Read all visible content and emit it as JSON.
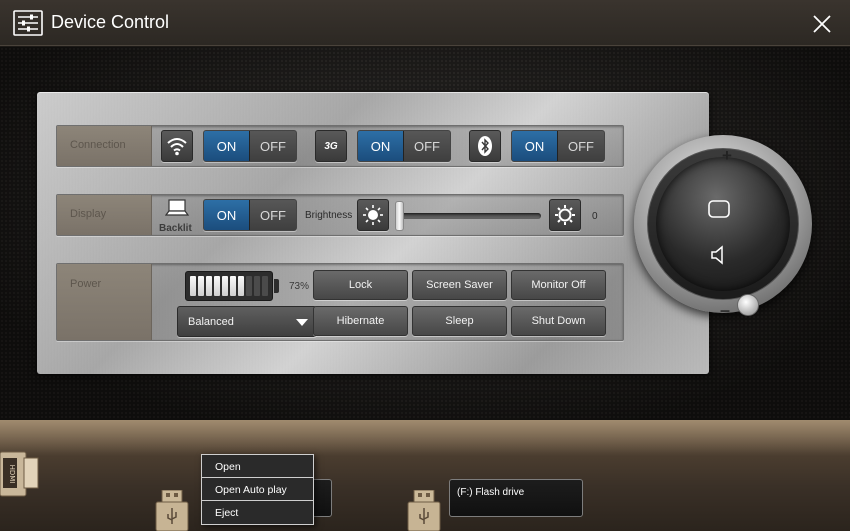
{
  "window": {
    "title": "Device Control",
    "close_icon": "close-icon",
    "app_icon": "sliders-icon"
  },
  "connection": {
    "label": "Connection",
    "wifi": {
      "icon": "wifi-icon",
      "on": "ON",
      "off": "OFF"
    },
    "mobile": {
      "icon_text": "3G",
      "on": "ON",
      "off": "OFF"
    },
    "bluetooth": {
      "icon": "bluetooth-icon",
      "on": "ON",
      "off": "OFF"
    }
  },
  "display": {
    "label": "Display",
    "backlit": {
      "icon": "laptop-icon",
      "label": "Backlit",
      "on": "ON",
      "off": "OFF"
    },
    "brightness": {
      "label": "Brightness",
      "value": "0",
      "level": 0
    }
  },
  "power": {
    "label": "Power",
    "battery_percent": "73%",
    "battery_level": 0.73,
    "plan": "Balanced",
    "buttons": {
      "lock": "Lock",
      "screen_saver": "Screen Saver",
      "monitor_off": "Monitor Off",
      "hibernate": "Hibernate",
      "sleep": "Sleep",
      "shut_down": "Shut Down"
    }
  },
  "volume": {
    "plus": "+",
    "minus": "–"
  },
  "devices": {
    "drive_f": "(F:) Flash drive",
    "hdmi_icon": "hdmi-icon",
    "usb_icon": "usb-drive-icon"
  },
  "context_menu": {
    "open": "Open",
    "open_auto_play": "Open Auto play",
    "eject": "Eject"
  },
  "colors": {
    "toggle_on": "#2d6fa6",
    "panel": "#bdbdbd",
    "shelf": "#4c3e30"
  }
}
